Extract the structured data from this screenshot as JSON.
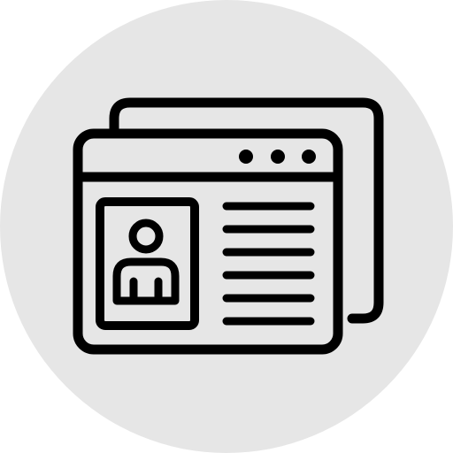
{
  "icon": {
    "name": "profile-webpage-icon",
    "background_color": "#e6e6e6",
    "stroke_color": "#000000",
    "window_fill": "#e6e6e6",
    "window_dots": 3,
    "text_lines": 6
  }
}
